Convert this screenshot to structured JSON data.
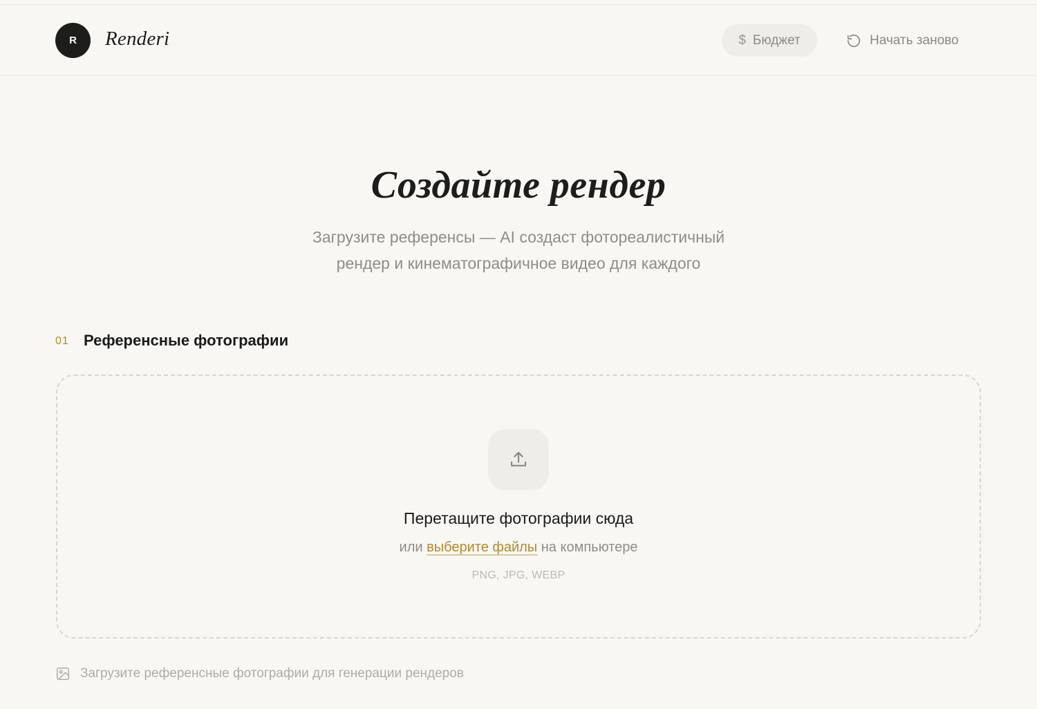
{
  "header": {
    "logo_letter": "R",
    "brand": "Renderi",
    "budget_label": "Бюджет",
    "budget_icon": "dollar-icon",
    "restart_label": "Начать заново",
    "restart_icon": "restart-icon"
  },
  "hero": {
    "title": "Создайте рендер",
    "subtitle_line1": "Загрузите референсы — AI создаст фотореалистичный",
    "subtitle_line2": "рендер и кинематографичное видео для каждого"
  },
  "section": {
    "number": "01",
    "title": "Референсные фотографии"
  },
  "dropzone": {
    "icon": "upload-icon",
    "title": "Перетащите фотографии сюда",
    "prefix": "или",
    "link": "выберите файлы",
    "suffix": "на компьютере",
    "formats": "PNG, JPG, WEBP"
  },
  "hint": {
    "icon": "image-icon",
    "text": "Загрузите референсные фотографии для генерации рендеров"
  },
  "colors": {
    "background": "#f8f7f3",
    "accent": "#b08a2c",
    "dark": "#1d1d1b",
    "muted": "#8f8d88"
  }
}
